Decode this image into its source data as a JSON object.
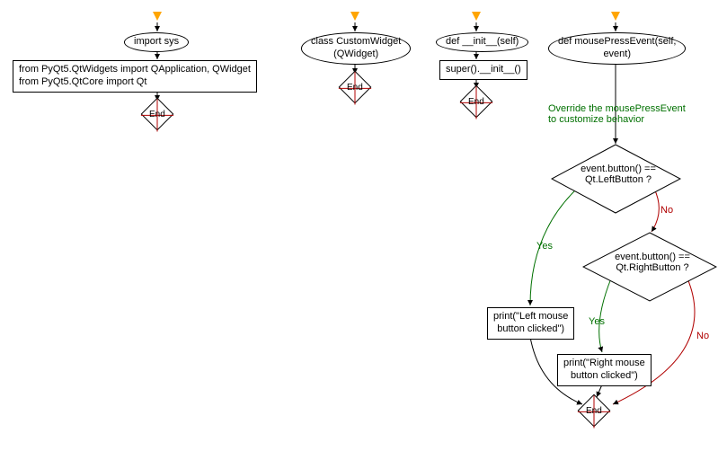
{
  "chart_data": [
    {
      "type": "flowchart",
      "id": "col1",
      "nodes": [
        {
          "id": "c1_start",
          "shape": "start",
          "text": ""
        },
        {
          "id": "c1_n1",
          "shape": "ellipse",
          "text": "import sys"
        },
        {
          "id": "c1_n2",
          "shape": "rect",
          "text": "from PyQt5.QtWidgets import QApplication, QWidget\nfrom PyQt5.QtCore import Qt"
        },
        {
          "id": "c1_end",
          "shape": "terminator",
          "text": "End"
        }
      ],
      "edges": [
        {
          "from": "c1_start",
          "to": "c1_n1"
        },
        {
          "from": "c1_n1",
          "to": "c1_n2"
        },
        {
          "from": "c1_n2",
          "to": "c1_end"
        }
      ]
    },
    {
      "type": "flowchart",
      "id": "col2",
      "nodes": [
        {
          "id": "c2_start",
          "shape": "start",
          "text": ""
        },
        {
          "id": "c2_n1",
          "shape": "ellipse",
          "text": "class CustomWidget\n(QWidget)"
        },
        {
          "id": "c2_end",
          "shape": "terminator",
          "text": "End"
        }
      ],
      "edges": [
        {
          "from": "c2_start",
          "to": "c2_n1"
        },
        {
          "from": "c2_n1",
          "to": "c2_end"
        }
      ]
    },
    {
      "type": "flowchart",
      "id": "col3",
      "nodes": [
        {
          "id": "c3_start",
          "shape": "start",
          "text": ""
        },
        {
          "id": "c3_n1",
          "shape": "ellipse",
          "text": "def __init__(self)"
        },
        {
          "id": "c3_n2",
          "shape": "rect",
          "text": "super().__init__()"
        },
        {
          "id": "c3_end",
          "shape": "terminator",
          "text": "End"
        }
      ],
      "edges": [
        {
          "from": "c3_start",
          "to": "c3_n1"
        },
        {
          "from": "c3_n1",
          "to": "c3_n2"
        },
        {
          "from": "c3_n2",
          "to": "c3_end"
        }
      ]
    },
    {
      "type": "flowchart",
      "id": "col4",
      "nodes": [
        {
          "id": "c4_start",
          "shape": "start",
          "text": ""
        },
        {
          "id": "c4_n1",
          "shape": "ellipse",
          "text": "def mousePressEvent(self,\nevent)"
        },
        {
          "id": "c4_comment",
          "shape": "comment",
          "text": "Override the mousePressEvent\nto customize behavior"
        },
        {
          "id": "c4_d1",
          "shape": "decision",
          "text": "event.button() ==\nQt.LeftButton ?"
        },
        {
          "id": "c4_d2",
          "shape": "decision",
          "text": "event.button() ==\nQt.RightButton ?"
        },
        {
          "id": "c4_p1",
          "shape": "rect",
          "text": "print(\"Left mouse\nbutton clicked\")"
        },
        {
          "id": "c4_p2",
          "shape": "rect",
          "text": "print(\"Right mouse\nbutton clicked\")"
        },
        {
          "id": "c4_end",
          "shape": "terminator",
          "text": "End"
        }
      ],
      "edges": [
        {
          "from": "c4_start",
          "to": "c4_n1"
        },
        {
          "from": "c4_n1",
          "to": "c4_d1",
          "label": ""
        },
        {
          "from": "c4_d1",
          "to": "c4_p1",
          "label": "Yes"
        },
        {
          "from": "c4_d1",
          "to": "c4_d2",
          "label": "No"
        },
        {
          "from": "c4_d2",
          "to": "c4_p2",
          "label": "Yes"
        },
        {
          "from": "c4_d2",
          "to": "c4_end",
          "label": "No"
        },
        {
          "from": "c4_p1",
          "to": "c4_end"
        },
        {
          "from": "c4_p2",
          "to": "c4_end"
        }
      ]
    }
  ],
  "labels": {
    "yes": "Yes",
    "no": "No",
    "end": "End"
  },
  "col1": {
    "n1": "import sys",
    "n2": "from PyQt5.QtWidgets import QApplication, QWidget\nfrom PyQt5.QtCore import Qt"
  },
  "col2": {
    "n1": "class CustomWidget\n(QWidget)"
  },
  "col3": {
    "n1": "def __init__(self)",
    "n2": "super().__init__()"
  },
  "col4": {
    "n1": "def mousePressEvent(self,\nevent)",
    "comment": "Override the mousePressEvent\nto customize behavior",
    "d1": "event.button() ==\nQt.LeftButton ?",
    "d2": "event.button() ==\nQt.RightButton ?",
    "p1": "print(\"Left mouse\nbutton clicked\")",
    "p2": "print(\"Right mouse\nbutton clicked\")"
  }
}
